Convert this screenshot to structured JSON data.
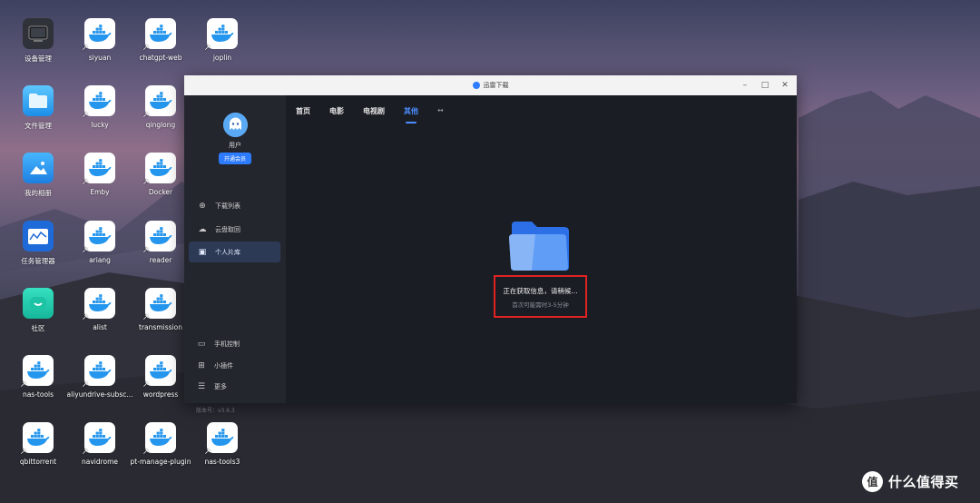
{
  "desktop": {
    "icons": [
      {
        "label": "设备管理",
        "kind": "device"
      },
      {
        "label": "siyuan",
        "kind": "docker"
      },
      {
        "label": "chatgpt-web",
        "kind": "docker"
      },
      {
        "label": "joplin",
        "kind": "docker"
      },
      {
        "label": "文件管理",
        "kind": "files"
      },
      {
        "label": "lucky",
        "kind": "docker"
      },
      {
        "label": "qinglong",
        "kind": "docker"
      },
      {
        "label": "我的相册",
        "kind": "photos"
      },
      {
        "label": "Emby",
        "kind": "docker"
      },
      {
        "label": "Docker",
        "kind": "docker"
      },
      {
        "label": "任务管理器",
        "kind": "taskmgr"
      },
      {
        "label": "ariang",
        "kind": "docker"
      },
      {
        "label": "reader",
        "kind": "docker"
      },
      {
        "label": "社区",
        "kind": "community"
      },
      {
        "label": "alist",
        "kind": "docker"
      },
      {
        "label": "transmission",
        "kind": "docker"
      },
      {
        "label": "nas-tools",
        "kind": "docker"
      },
      {
        "label": "aliyundrive-subsc...",
        "kind": "docker"
      },
      {
        "label": "wordpress",
        "kind": "docker"
      },
      {
        "label": "qbittorrent",
        "kind": "docker"
      },
      {
        "label": "navidrome",
        "kind": "docker"
      },
      {
        "label": "pt-manage-plugin",
        "kind": "docker"
      },
      {
        "label": "nas-tools3",
        "kind": "docker"
      }
    ]
  },
  "window": {
    "title": "迅雷下载",
    "controls": {
      "minimize": "–",
      "maximize": "□",
      "close": "✕"
    }
  },
  "sidebar": {
    "username": "用户",
    "vip_button": "开通会员",
    "items": [
      {
        "label": "下载列表",
        "icon": "download-icon",
        "glyph": "⊕",
        "active": false
      },
      {
        "label": "云盘取回",
        "icon": "cloud-icon",
        "glyph": "☁",
        "active": false
      },
      {
        "label": "个人片库",
        "icon": "library-icon",
        "glyph": "▣",
        "active": true
      }
    ],
    "bottom_items": [
      {
        "label": "手机控制",
        "icon": "phone-icon",
        "glyph": "▭"
      },
      {
        "label": "小插件",
        "icon": "plugin-icon",
        "glyph": "⊞"
      },
      {
        "label": "更多",
        "icon": "menu-icon",
        "glyph": "☰"
      }
    ],
    "version": "版本号：v3.6.3"
  },
  "tabs": [
    {
      "label": "首页",
      "active": false
    },
    {
      "label": "电影",
      "active": false
    },
    {
      "label": "电视剧",
      "active": false
    },
    {
      "label": "其他",
      "active": true
    },
    {
      "label": "↔",
      "active": false
    }
  ],
  "status": {
    "main": "正在获取信息，请稍候...",
    "sub": "首次可能需时3-5分钟"
  },
  "watermark": {
    "logo": "值",
    "text": "什么值得买"
  },
  "colors": {
    "accent": "#2d7bff",
    "highlight_box": "#e12222",
    "window_bg": "#1b1d24",
    "sidebar_bg": "#24262e"
  }
}
